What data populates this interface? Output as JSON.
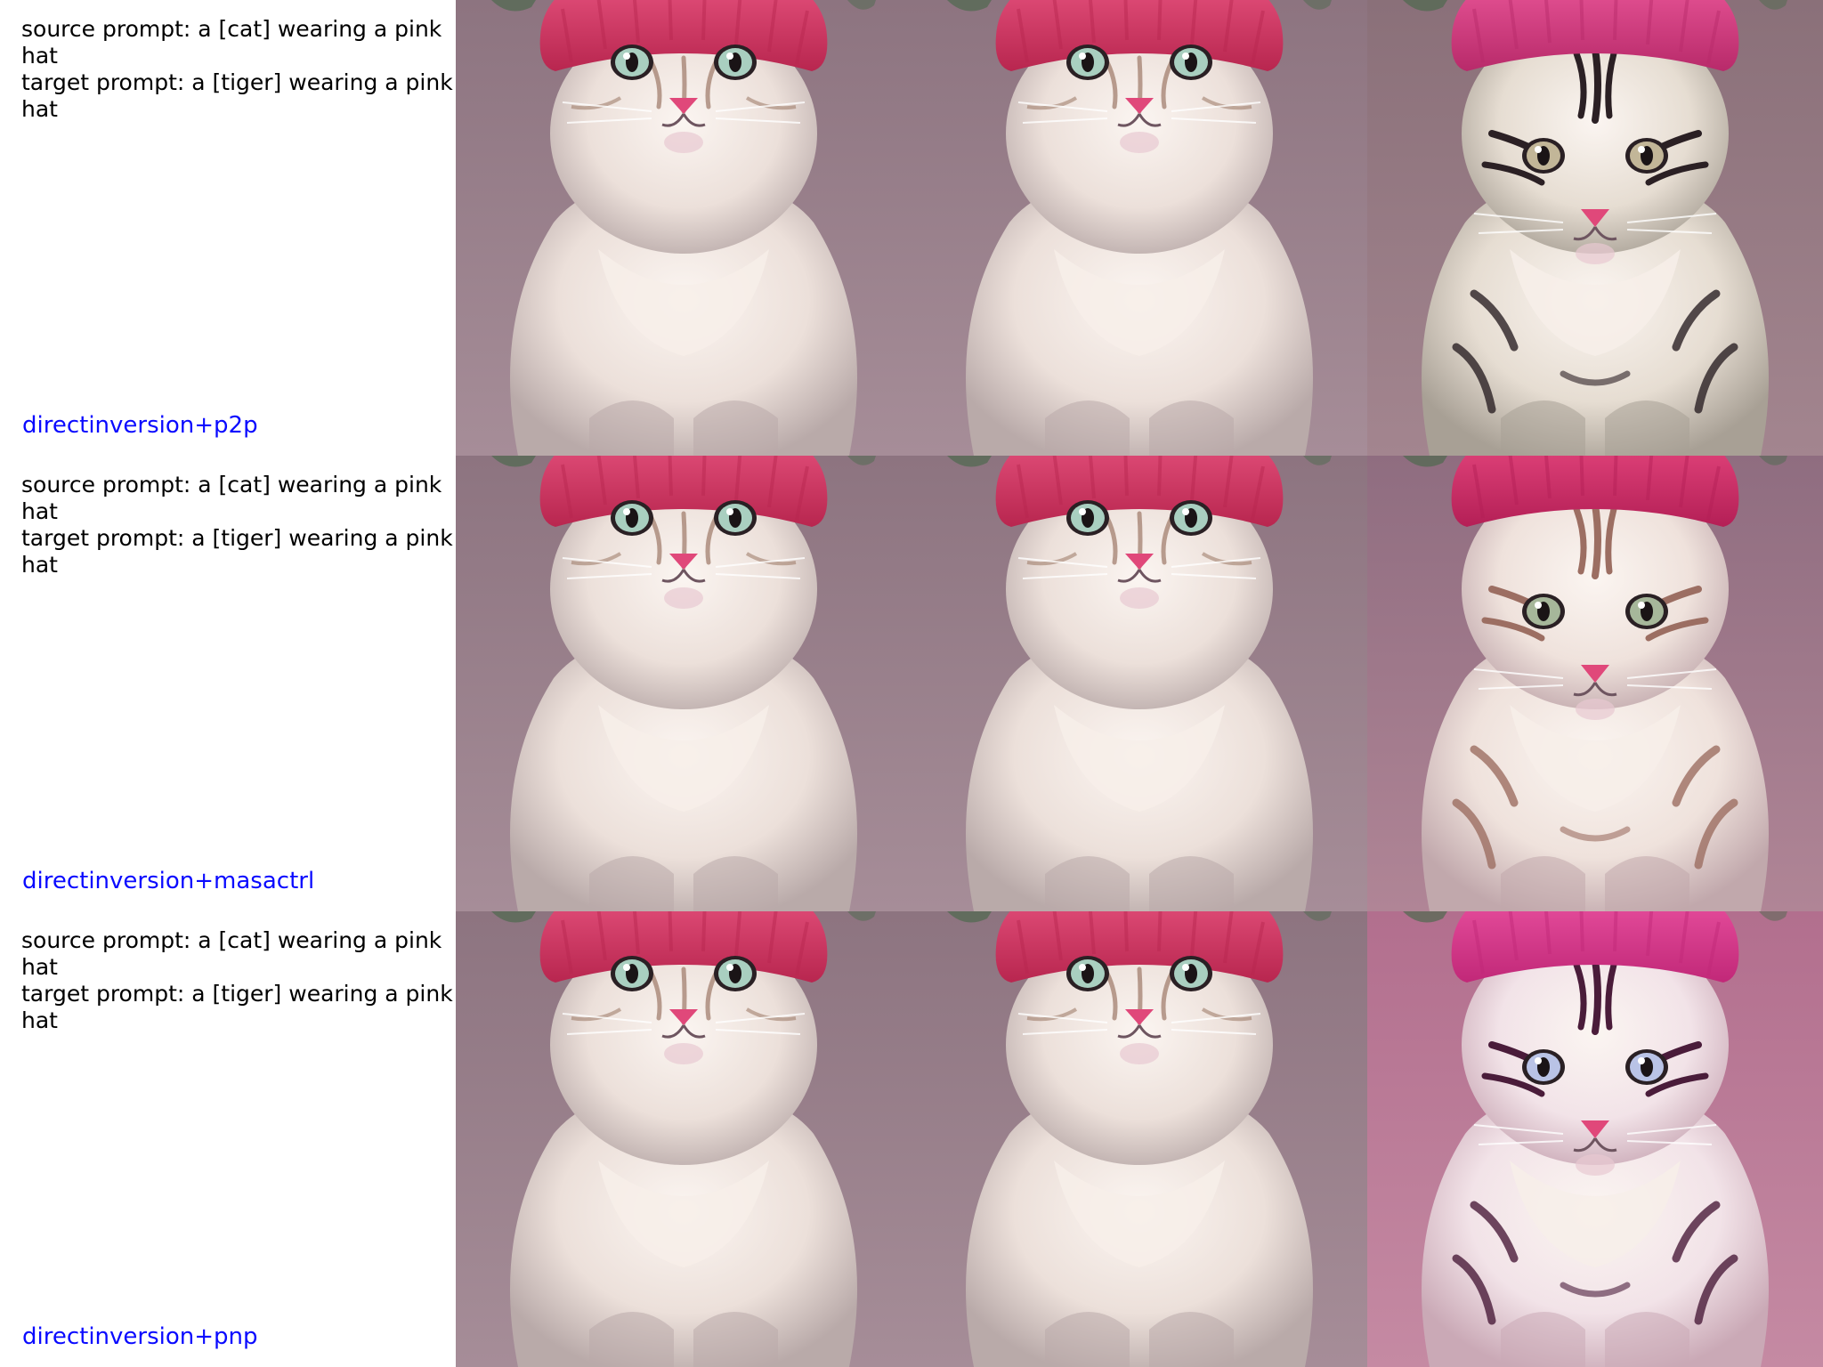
{
  "rows": [
    {
      "source_prompt": "source prompt: a [cat] wearing a pink hat",
      "target_prompt": "target prompt: a [tiger] wearing a pink hat",
      "method": "directinversion+p2p",
      "images": [
        "source-cat-image",
        "reconstructed-cat-image",
        "edited-tiger-image"
      ]
    },
    {
      "source_prompt": "source prompt: a [cat] wearing a pink hat",
      "target_prompt": "target prompt: a [tiger] wearing a pink hat",
      "method": "directinversion+masactrl",
      "images": [
        "source-cat-image",
        "reconstructed-cat-image",
        "edited-tiger-image"
      ]
    },
    {
      "source_prompt": "source prompt: a [cat] wearing a pink hat",
      "target_prompt": "target prompt: a [tiger] wearing a pink hat",
      "method": "directinversion+pnp",
      "images": [
        "source-cat-image",
        "reconstructed-cat-image",
        "edited-tiger-image"
      ]
    }
  ],
  "colors": {
    "method_label": "#0a0aff",
    "prompt_text": "#000000",
    "hat": "#e8406e",
    "background": "#9a7f8c"
  }
}
